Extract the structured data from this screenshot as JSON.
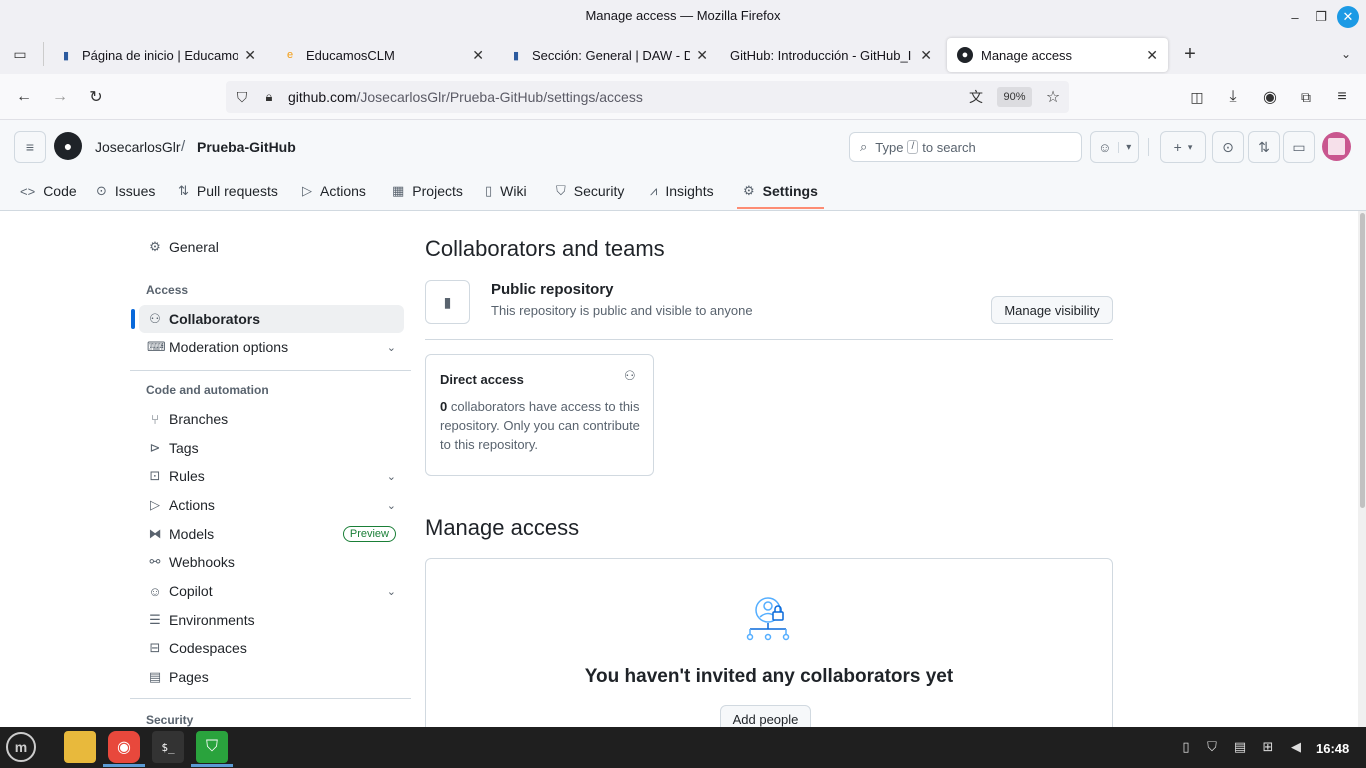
{
  "window": {
    "title": "Manage access — Mozilla Firefox",
    "minimize": "–",
    "maximize": "❐",
    "close": "✕"
  },
  "tabs": [
    {
      "label": "Página de inicio | Educamos(",
      "close": "✕"
    },
    {
      "label": "EducamosCLM",
      "close": "✕"
    },
    {
      "label": "Sección: General | DAW - Des",
      "close": "✕"
    },
    {
      "label": "GitHub: Introducción - GitHub_I",
      "close": "✕"
    },
    {
      "label": "Manage access",
      "close": "✕"
    }
  ],
  "browser": {
    "url_host": "github.com",
    "url_path": "/JosecarlosGlr/Prueba-GitHub/settings/access",
    "zoom": "90%"
  },
  "github": {
    "owner": "JosecarlosGlr",
    "separator": "/",
    "repo": "Prueba-GitHub",
    "search": {
      "pre": "Type",
      "key": "/",
      "post": "to search"
    },
    "tabs": [
      {
        "label": "Code",
        "icon": "<>"
      },
      {
        "label": "Issues",
        "icon": "⊙"
      },
      {
        "label": "Pull requests",
        "icon": "⇅"
      },
      {
        "label": "Actions",
        "icon": "▷"
      },
      {
        "label": "Projects",
        "icon": "▦"
      },
      {
        "label": "Wiki",
        "icon": "▯"
      },
      {
        "label": "Security",
        "icon": "⛉"
      },
      {
        "label": "Insights",
        "icon": "⩘"
      },
      {
        "label": "Settings",
        "icon": "⚙"
      }
    ]
  },
  "sidebar": {
    "general": "General",
    "access_heading": "Access",
    "collaborators": "Collaborators",
    "moderation": "Moderation options",
    "code_heading": "Code and automation",
    "items": [
      {
        "label": "Branches"
      },
      {
        "label": "Tags"
      },
      {
        "label": "Rules"
      },
      {
        "label": "Actions"
      },
      {
        "label": "Models"
      },
      {
        "label": "Webhooks"
      },
      {
        "label": "Copilot"
      },
      {
        "label": "Environments"
      },
      {
        "label": "Codespaces"
      },
      {
        "label": "Pages"
      }
    ],
    "preview_badge": "Preview",
    "security_heading": "Security"
  },
  "main": {
    "title": "Collaborators and teams",
    "public_title": "Public repository",
    "public_desc": "This repository is public and visible to anyone",
    "manage_visibility": "Manage visibility",
    "direct_access_title": "Direct access",
    "direct_count": "0",
    "direct_desc": " collaborators have access to this repository. Only you can contribute to this repository.",
    "manage_title": "Manage access",
    "empty_title": "You haven't invited any collaborators yet",
    "add_people": "Add people"
  },
  "taskbar": {
    "time": "16:48"
  }
}
